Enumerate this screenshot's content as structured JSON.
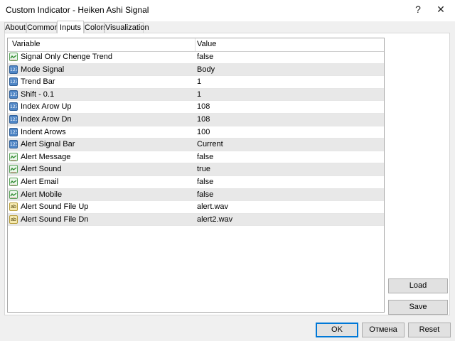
{
  "window": {
    "title": "Custom Indicator - Heiken Ashi Signal",
    "help_label": "?",
    "close_label": "✕"
  },
  "tabs": [
    {
      "label": "About"
    },
    {
      "label": "Common"
    },
    {
      "label": "Inputs",
      "active": true
    },
    {
      "label": "Colors"
    },
    {
      "label": "Visualization"
    }
  ],
  "grid": {
    "headers": {
      "variable": "Variable",
      "value": "Value"
    },
    "rows": [
      {
        "icon": "bool-param-icon",
        "variable": "Signal Only Chenge Trend",
        "value": "false"
      },
      {
        "icon": "number-param-icon",
        "variable": "Mode Signal",
        "value": "Body"
      },
      {
        "icon": "number-param-icon",
        "variable": "Trend Bar",
        "value": "1"
      },
      {
        "icon": "number-param-icon",
        "variable": "Shift - 0.1",
        "value": "1"
      },
      {
        "icon": "number-param-icon",
        "variable": "Index Arow Up",
        "value": "108"
      },
      {
        "icon": "number-param-icon",
        "variable": "Index Arow Dn",
        "value": "108"
      },
      {
        "icon": "number-param-icon",
        "variable": "Indent Arows",
        "value": "100"
      },
      {
        "icon": "number-param-icon",
        "variable": "Alert Signal Bar",
        "value": "Current"
      },
      {
        "icon": "bool-param-icon",
        "variable": "Alert Message",
        "value": "false"
      },
      {
        "icon": "bool-param-icon",
        "variable": "Alert Sound",
        "value": "true"
      },
      {
        "icon": "bool-param-icon",
        "variable": "Alert Email",
        "value": "false"
      },
      {
        "icon": "bool-param-icon",
        "variable": "Alert Mobile",
        "value": "false"
      },
      {
        "icon": "string-param-icon",
        "variable": "Alert Sound File Up",
        "value": "alert.wav"
      },
      {
        "icon": "string-param-icon",
        "variable": "Alert Sound File Dn",
        "value": "alert2.wav"
      }
    ]
  },
  "icon_text": {
    "number": "123",
    "string": "ab"
  },
  "side_buttons": {
    "load": "Load",
    "save": "Save"
  },
  "bottom_buttons": {
    "ok": "OK",
    "cancel": "Отмена",
    "reset": "Reset"
  },
  "colors": {
    "default_button_border": "#0078d7",
    "alt_row": "#e8e8e8"
  }
}
